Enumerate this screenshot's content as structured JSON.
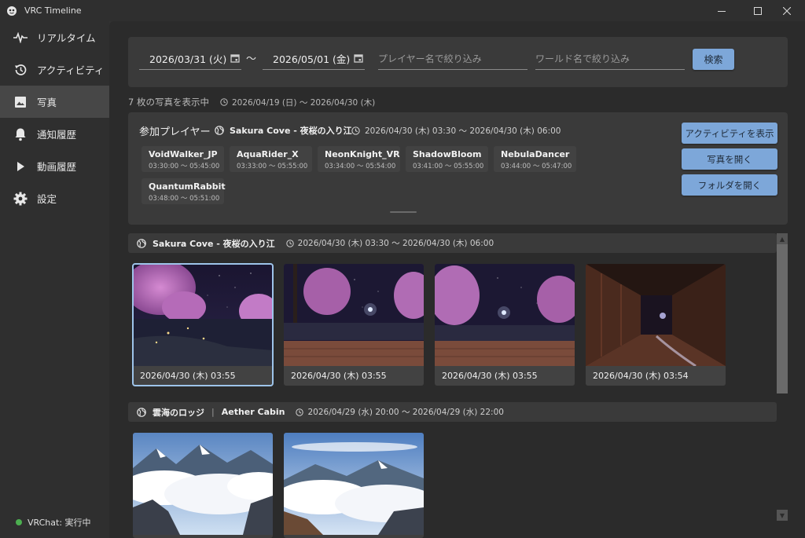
{
  "window": {
    "title": "VRC Timeline"
  },
  "sidebar": {
    "items": [
      {
        "label": "リアルタイム",
        "icon": "pulse-icon"
      },
      {
        "label": "アクティビティ",
        "icon": "history-icon"
      },
      {
        "label": "写真",
        "icon": "image-icon",
        "active": true
      },
      {
        "label": "通知履歴",
        "icon": "bell-icon"
      },
      {
        "label": "動画履歴",
        "icon": "play-icon"
      },
      {
        "label": "設定",
        "icon": "gear-icon"
      }
    ],
    "status": "VRChat: 実行中",
    "status_color": "#4caf50"
  },
  "filter": {
    "start_date": "2026/03/31 (火)",
    "separator": "〜",
    "end_date": "2026/05/01 (金)",
    "player_placeholder": "プレイヤー名で絞り込み",
    "world_placeholder": "ワールド名で絞り込み",
    "search_label": "検索"
  },
  "summary": {
    "count_text": "7 枚の写真を表示中",
    "range_text": "2026/04/19 (日) 〜 2026/04/30 (木)"
  },
  "players_card": {
    "title": "参加プレイヤー",
    "world": "Sakura Cove - 夜桜の入り江",
    "time_range": "2026/04/30 (木) 03:30 〜 2026/04/30 (木) 06:00",
    "players": [
      {
        "name": "VoidWalker_JP",
        "time": "03:30:00 〜 05:45:00"
      },
      {
        "name": "AquaRider_X",
        "time": "03:33:00 〜 05:55:00"
      },
      {
        "name": "NeonKnight_VR",
        "time": "03:34:00 〜 05:54:00"
      },
      {
        "name": "ShadowBloom",
        "time": "03:41:00 〜 05:55:00"
      },
      {
        "name": "NebulaDancer",
        "time": "03:44:00 〜 05:47:00"
      },
      {
        "name": "QuantumRabbit",
        "time": "03:48:00 〜 05:51:00"
      }
    ],
    "buttons": {
      "activity": "アクティビティを表示",
      "open_photo": "写真を開く",
      "open_folder": "フォルダを開く"
    }
  },
  "groups": [
    {
      "world": "Sakura Cove - 夜桜の入り江",
      "time_range": "2026/04/30 (木) 03:30 〜 2026/04/30 (木) 06:00",
      "photos": [
        {
          "date": "2026/04/30 (木) 03:55",
          "scene": "sakura-night",
          "selected": true
        },
        {
          "date": "2026/04/30 (木) 03:55",
          "scene": "sakura-deck"
        },
        {
          "date": "2026/04/30 (木) 03:55",
          "scene": "sakura-deck"
        },
        {
          "date": "2026/04/30 (木) 03:54",
          "scene": "corridor"
        }
      ]
    },
    {
      "world": "雲海のロッジ",
      "world_sub": "Aether Cabin",
      "divider": "|",
      "time_range": "2026/04/29 (水) 20:00 〜 2026/04/29 (水) 22:00",
      "photos": [
        {
          "scene": "mountain-clouds"
        },
        {
          "scene": "mountain-clouds-2"
        }
      ]
    }
  ],
  "colors": {
    "accent": "#7da7d9",
    "selected_outline": "#9ec4ea",
    "background": "#2b2b2b",
    "card": "#3a3a3a"
  }
}
